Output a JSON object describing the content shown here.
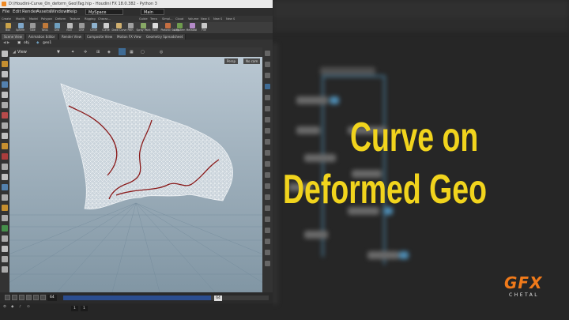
{
  "window": {
    "title": "D:\\Houdini-Curve_On_deform_Geo\\Tag.hip - Houdini FX 18.0.382 - Python 3"
  },
  "menu": {
    "items": [
      "File",
      "Edit",
      "Render",
      "Assets",
      "Windows",
      "Help"
    ],
    "desktop": "MySpace",
    "desktop2": "Main"
  },
  "shelf_tabs": [
    "Create",
    "Modify",
    "Model",
    "Polygon",
    "Deform",
    "Texture",
    "Rigging",
    "Charac...",
    "Guide",
    "Terra",
    "Simpl...",
    "Cloud",
    "Volume",
    "New S",
    "New S",
    "New S"
  ],
  "tools": [
    {
      "label": "Box",
      "color": "#c9a24a"
    },
    {
      "label": "Sphere",
      "color": "#7fa7c9"
    },
    {
      "label": "Tube",
      "color": "#9a9a9a"
    },
    {
      "label": "Torus",
      "color": "#c07a3a"
    },
    {
      "label": "Grid",
      "color": "#6fa0c0"
    },
    {
      "label": "Null",
      "color": "#bbbbbb"
    },
    {
      "label": "Line",
      "color": "#999999"
    },
    {
      "label": "Circle",
      "color": "#8fb3cf"
    },
    {
      "label": "Curve",
      "color": "#cfcfcf"
    },
    {
      "label": "Draw Curve",
      "color": "#d0b070"
    },
    {
      "label": "Path",
      "color": "#a0a0a0"
    },
    {
      "label": "Spray Paint",
      "color": "#88aa66"
    },
    {
      "label": "Font",
      "color": "#dddddd"
    },
    {
      "label": "Platonic Solids",
      "color": "#c56f42"
    },
    {
      "label": "L-System",
      "color": "#6f9c4e"
    },
    {
      "label": "Metaball",
      "color": "#b48ac9"
    },
    {
      "label": "File",
      "color": "#c9c9c9"
    }
  ],
  "pane_tabs": [
    "Scene View",
    "Animation Editor",
    "Render View",
    "Composite View",
    "Motion FX View",
    "Geometry Spreadsheet"
  ],
  "path": {
    "obj": "obj",
    "node": "geo1"
  },
  "viewport": {
    "label": "View",
    "camera": "Persp",
    "cam_menu": "No cam"
  },
  "timeline": {
    "frame": "64",
    "current_frame": "64",
    "progress": 0.72
  },
  "bottom": {
    "start": "1",
    "end": "1"
  },
  "headline": {
    "line1": "Curve on",
    "line2": "Deformed Geo"
  },
  "logo": {
    "mark": "GFX",
    "sub": "CHETAL"
  },
  "colors": {
    "accent": "#f1d41d",
    "logo": "#f07a1a",
    "curve": "#8a1a1a"
  }
}
